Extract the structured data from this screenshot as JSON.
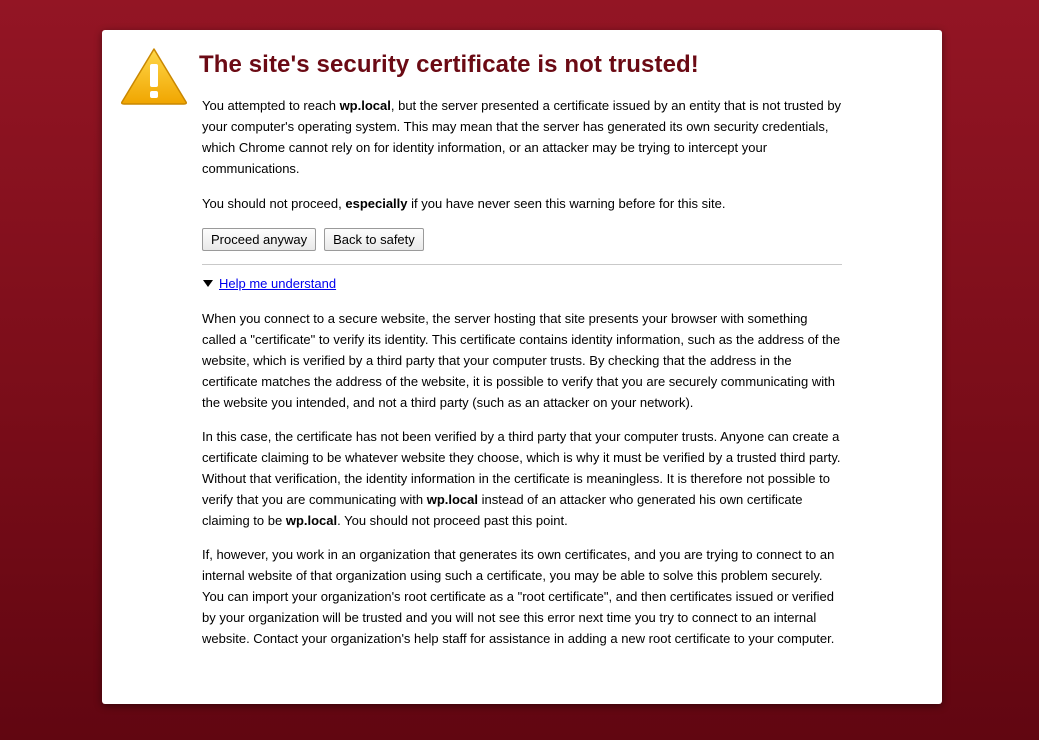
{
  "title": "The site's security certificate is not trusted!",
  "icon": "warning-triangle-icon",
  "colors": {
    "background": "#7a0d19",
    "title": "#6b0a14",
    "link": "#0000ee",
    "icon_fill": "#f5b400"
  },
  "intro": {
    "before": "You attempted to reach ",
    "host": "wp.local",
    "after": ", but the server presented a certificate issued by an entity that is not trusted by your computer's operating system. This may mean that the server has generated its own security credentials, which Chrome cannot rely on for identity information, or an attacker may be trying to intercept your communications."
  },
  "warning": {
    "before": "You should not proceed, ",
    "emphasis": "especially",
    "after": " if you have never seen this warning before for this site."
  },
  "buttons": {
    "proceed": "Proceed anyway",
    "back": "Back to safety"
  },
  "help": {
    "link": "Help me understand",
    "paragraph1": "When you connect to a secure website, the server hosting that site presents your browser with something called a \"certificate\" to verify its identity. This certificate contains identity information, such as the address of the website, which is verified by a third party that your computer trusts. By checking that the address in the certificate matches the address of the website, it is possible to verify that you are securely communicating with the website you intended, and not a third party (such as an attacker on your network).",
    "paragraph2": {
      "part1": "In this case, the certificate has not been verified by a third party that your computer trusts. Anyone can create a certificate claiming to be whatever website they choose, which is why it must be verified by a trusted third party. Without that verification, the identity information in the certificate is meaningless. It is therefore not possible to verify that you are communicating with ",
      "host1": "wp.local",
      "part2": " instead of an attacker who generated his own certificate claiming to be ",
      "host2": "wp.local",
      "part3": ". You should not proceed past this point."
    },
    "paragraph3": "If, however, you work in an organization that generates its own certificates, and you are trying to connect to an internal website of that organization using such a certificate, you may be able to solve this problem securely. You can import your organization's root certificate as a \"root certificate\", and then certificates issued or verified by your organization will be trusted and you will not see this error next time you try to connect to an internal website. Contact your organization's help staff for assistance in adding a new root certificate to your computer."
  }
}
